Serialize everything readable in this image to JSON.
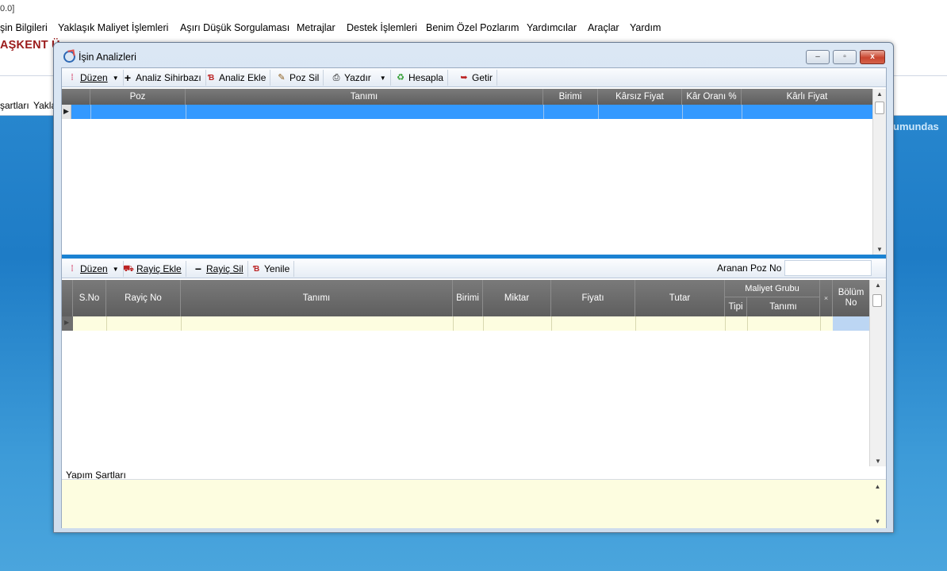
{
  "app": {
    "title_fragment": "0.0]",
    "menu": [
      "şin Bilgileri",
      "Yaklaşık Maliyet İşlemleri",
      "Aşırı Düşük Sorgulaması",
      "Metrajlar",
      "Destek İşlemleri",
      "Benim Özel Pozlarım",
      "Yardımcılar",
      "Araçlar",
      "Yardım"
    ],
    "brand": "AŞKENT Ü",
    "tabs": [
      "şartları",
      "Yakla"
    ],
    "right_text": "umundas"
  },
  "dialog": {
    "title": "İşin Analizleri",
    "window_buttons": {
      "minimize": "–",
      "maximize": "▫",
      "close": "x"
    },
    "top_toolbar": {
      "duzen": "Düzen",
      "analiz_sihirbazi": "Analiz Sihirbazı",
      "analiz_ekle": "Analiz Ekle",
      "poz_sil": "Poz Sil",
      "yazdir": "Yazdır",
      "hesapla": "Hesapla",
      "getir": "Getir"
    },
    "top_grid": {
      "columns": [
        "Poz",
        "Tanımı",
        "Birimi",
        "Kârsız Fiyat",
        "Kâr Oranı %",
        "Kârlı Fiyat"
      ]
    },
    "bottom_toolbar": {
      "duzen": "Düzen",
      "rayic_ekle": "Rayiç Ekle",
      "rayic_sil": "Rayiç Sil",
      "yenile": "Yenile",
      "search_label": "Aranan Poz No",
      "search_value": ""
    },
    "bottom_grid": {
      "columns": [
        "S.No",
        "Rayiç No",
        "Tanımı",
        "Birimi",
        "Miktar",
        "Fiyatı",
        "Tutar"
      ],
      "group_header": "Maliyet Grubu",
      "group_sub": [
        "Tipi",
        "Tanımı"
      ],
      "bolum_no": "Bölüm No",
      "small_col": "×"
    },
    "notes_label": "Yapım Şartları",
    "notes_value": ""
  }
}
